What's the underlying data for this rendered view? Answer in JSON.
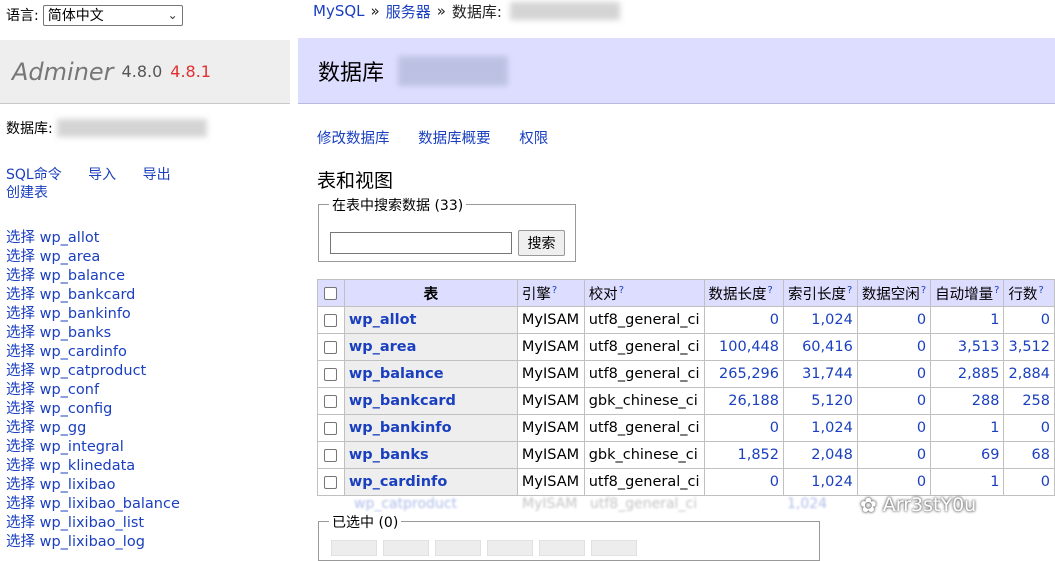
{
  "lang": {
    "label": "语言:",
    "value": "简体中文"
  },
  "brand": {
    "name": "Adminer",
    "version": "4.8.0",
    "new_version": "4.8.1"
  },
  "sidebar": {
    "db_label": "数据库:",
    "commands": {
      "sql": "SQL命令",
      "import": "导入",
      "export": "导出",
      "create_table": "创建表"
    },
    "select_prefix": "选择",
    "tables": [
      "wp_allot",
      "wp_area",
      "wp_balance",
      "wp_bankcard",
      "wp_bankinfo",
      "wp_banks",
      "wp_cardinfo",
      "wp_catproduct",
      "wp_conf",
      "wp_config",
      "wp_gg",
      "wp_integral",
      "wp_klinedata",
      "wp_lixibao",
      "wp_lixibao_balance",
      "wp_lixibao_list",
      "wp_lixibao_log"
    ]
  },
  "breadcrumb": {
    "driver": "MySQL",
    "sep": "»",
    "server": "服务器",
    "db": "数据库:"
  },
  "header": {
    "title": "数据库"
  },
  "links": {
    "alter": "修改数据库",
    "schema": "数据库概要",
    "privileges": "权限"
  },
  "section": {
    "title": "表和视图"
  },
  "search": {
    "legend": "在表中搜索数据 (33)",
    "button": "搜索",
    "value": ""
  },
  "table": {
    "headers": {
      "name": "表",
      "engine": "引擎",
      "collation": "校对",
      "data_length": "数据长度",
      "index_length": "索引长度",
      "data_free": "数据空闲",
      "auto_increment": "自动增量",
      "rows": "行数",
      "help": "?"
    },
    "rows": [
      {
        "name": "wp_allot",
        "engine": "MyISAM",
        "collation": "utf8_general_ci",
        "data_length": "0",
        "index_length": "1,024",
        "data_free": "0",
        "auto_increment": "1",
        "rows": "0"
      },
      {
        "name": "wp_area",
        "engine": "MyISAM",
        "collation": "utf8_general_ci",
        "data_length": "100,448",
        "index_length": "60,416",
        "data_free": "0",
        "auto_increment": "3,513",
        "rows": "3,512"
      },
      {
        "name": "wp_balance",
        "engine": "MyISAM",
        "collation": "utf8_general_ci",
        "data_length": "265,296",
        "index_length": "31,744",
        "data_free": "0",
        "auto_increment": "2,885",
        "rows": "2,884"
      },
      {
        "name": "wp_bankcard",
        "engine": "MyISAM",
        "collation": "gbk_chinese_ci",
        "data_length": "26,188",
        "index_length": "5,120",
        "data_free": "0",
        "auto_increment": "288",
        "rows": "258"
      },
      {
        "name": "wp_bankinfo",
        "engine": "MyISAM",
        "collation": "utf8_general_ci",
        "data_length": "0",
        "index_length": "1,024",
        "data_free": "0",
        "auto_increment": "1",
        "rows": "0"
      },
      {
        "name": "wp_banks",
        "engine": "MyISAM",
        "collation": "gbk_chinese_ci",
        "data_length": "1,852",
        "index_length": "2,048",
        "data_free": "0",
        "auto_increment": "69",
        "rows": "68"
      },
      {
        "name": "wp_cardinfo",
        "engine": "MyISAM",
        "collation": "utf8_general_ci",
        "data_length": "0",
        "index_length": "1,024",
        "data_free": "0",
        "auto_increment": "1",
        "rows": "0"
      }
    ],
    "faded_row": {
      "name": "wp_catproduct",
      "engine": "MyISAM",
      "collation": "utf8_general_ci",
      "index_length": "1,024"
    }
  },
  "selected": {
    "legend": "已选中 (0)"
  },
  "watermark": {
    "text": "Arr3stY0u"
  },
  "colors": {
    "link": "#1a3fbf",
    "header_bg": "#ddf",
    "new_version": "#e03030"
  }
}
